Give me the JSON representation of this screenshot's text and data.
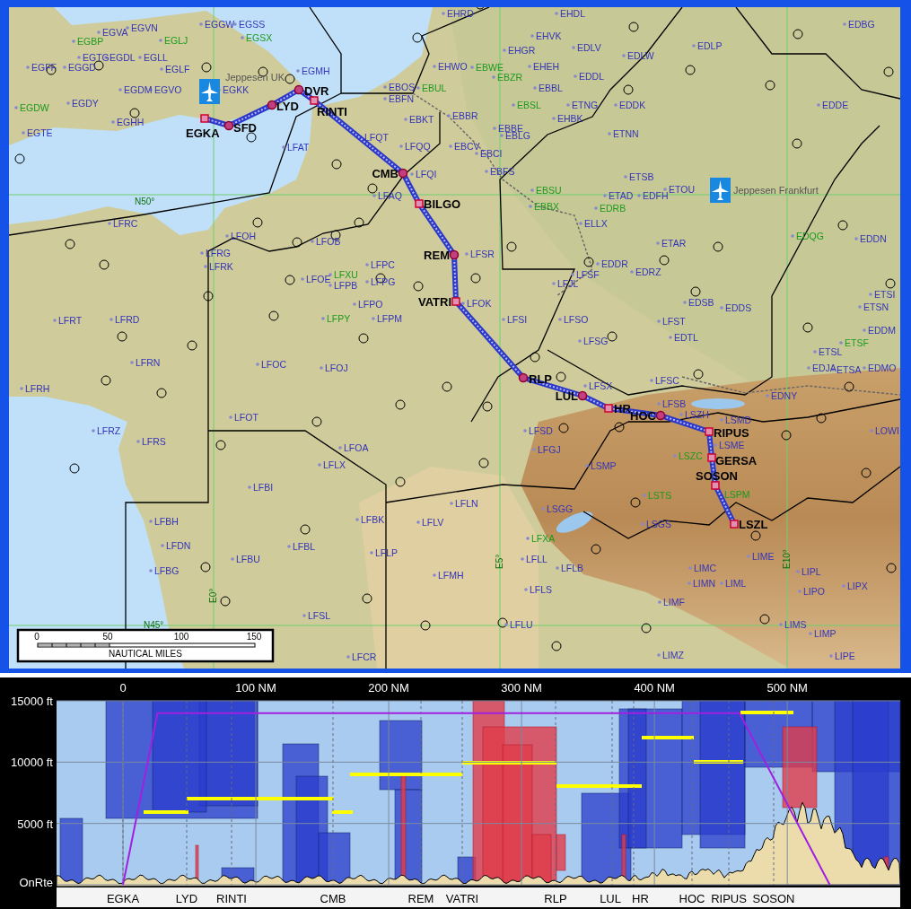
{
  "map": {
    "airports": [
      {
        "text": "EHRD",
        "color": "#3434b8"
      },
      {
        "text": "EHDL",
        "color": "#3434b8"
      },
      {
        "text": "EGVA",
        "color": "#3434b8"
      },
      {
        "text": "EGVN",
        "color": "#3434b8"
      },
      {
        "text": "EGGW",
        "color": "#3434b8"
      },
      {
        "text": "EGSS",
        "color": "#3434b8"
      },
      {
        "text": "EDBG",
        "color": "#3434b8"
      },
      {
        "text": "EGBP",
        "color": "#1c9a1c"
      },
      {
        "text": "EGLJ",
        "color": "#1c9a1c"
      },
      {
        "text": "EGSX",
        "color": "#1c9a1c"
      },
      {
        "text": "EHVK",
        "color": "#3434b8"
      },
      {
        "text": "EGTG",
        "color": "#3434b8"
      },
      {
        "text": "EGDL",
        "color": "#3434b8"
      },
      {
        "text": "EGLL",
        "color": "#3434b8"
      },
      {
        "text": "EHGR",
        "color": "#3434b8"
      },
      {
        "text": "EDLV",
        "color": "#3434b8"
      },
      {
        "text": "EDLW",
        "color": "#3434b8"
      },
      {
        "text": "EDLP",
        "color": "#3434b8"
      },
      {
        "text": "EGFF",
        "color": "#3434b8"
      },
      {
        "text": "EGGD",
        "color": "#3434b8"
      },
      {
        "text": "EGLF",
        "color": "#3434b8"
      },
      {
        "text": "EGMH",
        "color": "#3434b8"
      },
      {
        "text": "EHWO",
        "color": "#3434b8"
      },
      {
        "text": "EBWE",
        "color": "#1c9a1c"
      },
      {
        "text": "EHEH",
        "color": "#3434b8"
      },
      {
        "text": "EBZR",
        "color": "#1c9a1c"
      },
      {
        "text": "EDDL",
        "color": "#3434b8"
      },
      {
        "text": "EGDM",
        "color": "#3434b8"
      },
      {
        "text": "EGVO",
        "color": "#3434b8"
      },
      {
        "text": "EGKK",
        "color": "#3434b8"
      },
      {
        "text": "EBOS",
        "color": "#3434b8"
      },
      {
        "text": "EBUL",
        "color": "#1c9a1c"
      },
      {
        "text": "EBBL",
        "color": "#3434b8"
      },
      {
        "text": "EGDW",
        "color": "#1c9a1c"
      },
      {
        "text": "EGDY",
        "color": "#3434b8"
      },
      {
        "text": "EBFN",
        "color": "#3434b8"
      },
      {
        "text": "EBSL",
        "color": "#1c9a1c"
      },
      {
        "text": "ETNG",
        "color": "#3434b8"
      },
      {
        "text": "EDDK",
        "color": "#3434b8"
      },
      {
        "text": "EDDE",
        "color": "#3434b8"
      },
      {
        "text": "EGHH",
        "color": "#3434b8"
      },
      {
        "text": "EBKT",
        "color": "#3434b8"
      },
      {
        "text": "EBBR",
        "color": "#3434b8"
      },
      {
        "text": "EHBK",
        "color": "#3434b8"
      },
      {
        "text": "EGTE",
        "color": "#3434b8"
      },
      {
        "text": "LFQT",
        "color": "#3434b8"
      },
      {
        "text": "EBBE",
        "color": "#3434b8"
      },
      {
        "text": "EBLG",
        "color": "#3434b8"
      },
      {
        "text": "ETNN",
        "color": "#3434b8"
      },
      {
        "text": "LFAT",
        "color": "#3434b8"
      },
      {
        "text": "LFQQ",
        "color": "#3434b8"
      },
      {
        "text": "EBCV",
        "color": "#3434b8"
      },
      {
        "text": "EBCI",
        "color": "#3434b8"
      },
      {
        "text": "LFQI",
        "color": "#3434b8"
      },
      {
        "text": "EBFS",
        "color": "#3434b8"
      },
      {
        "text": "ETSB",
        "color": "#3434b8"
      },
      {
        "text": "LFAQ",
        "color": "#3434b8"
      },
      {
        "text": "EBSU",
        "color": "#1c9a1c"
      },
      {
        "text": "ETAD",
        "color": "#3434b8"
      },
      {
        "text": "EDFH",
        "color": "#3434b8"
      },
      {
        "text": "ETOU",
        "color": "#3434b8"
      },
      {
        "text": "EBBX",
        "color": "#1c9a1c"
      },
      {
        "text": "EDRB",
        "color": "#1c9a1c"
      },
      {
        "text": "LFRC",
        "color": "#3434b8"
      },
      {
        "text": "ELLX",
        "color": "#3434b8"
      },
      {
        "text": "LFOH",
        "color": "#3434b8"
      },
      {
        "text": "LFOB",
        "color": "#3434b8"
      },
      {
        "text": "ETAR",
        "color": "#3434b8"
      },
      {
        "text": "EDQG",
        "color": "#1c9a1c"
      },
      {
        "text": "EDDN",
        "color": "#3434b8"
      },
      {
        "text": "LFRG",
        "color": "#3434b8"
      },
      {
        "text": "LFSR",
        "color": "#3434b8"
      },
      {
        "text": "LFRK",
        "color": "#3434b8"
      },
      {
        "text": "LFPC",
        "color": "#3434b8"
      },
      {
        "text": "EDDR",
        "color": "#3434b8"
      },
      {
        "text": "LFOE",
        "color": "#3434b8"
      },
      {
        "text": "LFXU",
        "color": "#1c9a1c"
      },
      {
        "text": "LFPB",
        "color": "#3434b8"
      },
      {
        "text": "LFPG",
        "color": "#3434b8"
      },
      {
        "text": "LFJL",
        "color": "#3434b8"
      },
      {
        "text": "LFSF",
        "color": "#3434b8"
      },
      {
        "text": "EDRZ",
        "color": "#3434b8"
      },
      {
        "text": "LFPO",
        "color": "#3434b8"
      },
      {
        "text": "LFOK",
        "color": "#3434b8"
      },
      {
        "text": "EDSB",
        "color": "#3434b8"
      },
      {
        "text": "EDDS",
        "color": "#3434b8"
      },
      {
        "text": "ETSN",
        "color": "#3434b8"
      },
      {
        "text": "ETSI",
        "color": "#3434b8"
      },
      {
        "text": "LFRT",
        "color": "#3434b8"
      },
      {
        "text": "LFRD",
        "color": "#3434b8"
      },
      {
        "text": "LFPY",
        "color": "#1c9a1c"
      },
      {
        "text": "LFPM",
        "color": "#3434b8"
      },
      {
        "text": "LFSI",
        "color": "#3434b8"
      },
      {
        "text": "LFSO",
        "color": "#3434b8"
      },
      {
        "text": "LFST",
        "color": "#3434b8"
      },
      {
        "text": "LFSG",
        "color": "#3434b8"
      },
      {
        "text": "EDTL",
        "color": "#3434b8"
      },
      {
        "text": "EDDM",
        "color": "#3434b8"
      },
      {
        "text": "ETSL",
        "color": "#3434b8"
      },
      {
        "text": "ETSF",
        "color": "#1c9a1c"
      },
      {
        "text": "LFRN",
        "color": "#3434b8"
      },
      {
        "text": "LFOC",
        "color": "#3434b8"
      },
      {
        "text": "LFOJ",
        "color": "#3434b8"
      },
      {
        "text": "EDJA",
        "color": "#3434b8"
      },
      {
        "text": "ETSA",
        "color": "#3434b8"
      },
      {
        "text": "EDMO",
        "color": "#3434b8"
      },
      {
        "text": "LFRH",
        "color": "#3434b8"
      },
      {
        "text": "LFSX",
        "color": "#3434b8"
      },
      {
        "text": "LFSC",
        "color": "#3434b8"
      },
      {
        "text": "LFSB",
        "color": "#3434b8"
      },
      {
        "text": "EDNY",
        "color": "#3434b8"
      },
      {
        "text": "LFOT",
        "color": "#3434b8"
      },
      {
        "text": "LSZH",
        "color": "#3434b8"
      },
      {
        "text": "LSMD",
        "color": "#3434b8"
      },
      {
        "text": "LFRZ",
        "color": "#3434b8"
      },
      {
        "text": "LFSD",
        "color": "#3434b8"
      },
      {
        "text": "LOWI",
        "color": "#3434b8"
      },
      {
        "text": "LFRS",
        "color": "#3434b8"
      },
      {
        "text": "LFOA",
        "color": "#3434b8"
      },
      {
        "text": "LFGJ",
        "color": "#3434b8"
      },
      {
        "text": "LSME",
        "color": "#3434b8"
      },
      {
        "text": "LFLX",
        "color": "#3434b8"
      },
      {
        "text": "LSMP",
        "color": "#3434b8"
      },
      {
        "text": "LSZC",
        "color": "#1c9a1c"
      },
      {
        "text": "LFBI",
        "color": "#3434b8"
      },
      {
        "text": "LFLN",
        "color": "#3434b8"
      },
      {
        "text": "LSTS",
        "color": "#1c9a1c"
      },
      {
        "text": "LSPM",
        "color": "#1c9a1c"
      },
      {
        "text": "LSGG",
        "color": "#3434b8"
      },
      {
        "text": "LFBH",
        "color": "#3434b8"
      },
      {
        "text": "LFBK",
        "color": "#3434b8"
      },
      {
        "text": "LFLV",
        "color": "#3434b8"
      },
      {
        "text": "LSGS",
        "color": "#3434b8"
      },
      {
        "text": "LFDN",
        "color": "#3434b8"
      },
      {
        "text": "LFBL",
        "color": "#3434b8"
      },
      {
        "text": "LFXA",
        "color": "#1c9a1c"
      },
      {
        "text": "LFBU",
        "color": "#3434b8"
      },
      {
        "text": "LFLP",
        "color": "#3434b8"
      },
      {
        "text": "LFLL",
        "color": "#3434b8"
      },
      {
        "text": "LIME",
        "color": "#3434b8"
      },
      {
        "text": "LFBG",
        "color": "#3434b8"
      },
      {
        "text": "LFMH",
        "color": "#3434b8"
      },
      {
        "text": "LFLB",
        "color": "#3434b8"
      },
      {
        "text": "LIMC",
        "color": "#3434b8"
      },
      {
        "text": "LIPL",
        "color": "#3434b8"
      },
      {
        "text": "LFLS",
        "color": "#3434b8"
      },
      {
        "text": "LIMN",
        "color": "#3434b8"
      },
      {
        "text": "LIML",
        "color": "#3434b8"
      },
      {
        "text": "LIPO",
        "color": "#3434b8"
      },
      {
        "text": "LIPX",
        "color": "#3434b8"
      },
      {
        "text": "LIMF",
        "color": "#3434b8"
      },
      {
        "text": "LFSL",
        "color": "#3434b8"
      },
      {
        "text": "LFLU",
        "color": "#3434b8"
      },
      {
        "text": "LIMS",
        "color": "#3434b8"
      },
      {
        "text": "LIMP",
        "color": "#3434b8"
      },
      {
        "text": "LFCR",
        "color": "#3434b8"
      },
      {
        "text": "LIMZ",
        "color": "#3434b8"
      },
      {
        "text": "LIPE",
        "color": "#3434b8"
      }
    ],
    "waypoints": [
      {
        "text": "EGKA",
        "kind": "fix"
      },
      {
        "text": "SFD",
        "kind": "navaid"
      },
      {
        "text": "LYD",
        "kind": "navaid"
      },
      {
        "text": "DVR",
        "kind": "navaid"
      },
      {
        "text": "RINTI",
        "kind": "fix"
      },
      {
        "text": "CMB",
        "kind": "navaid"
      },
      {
        "text": "BILGO",
        "kind": "fix"
      },
      {
        "text": "REM",
        "kind": "navaid"
      },
      {
        "text": "VATRI",
        "kind": "fix"
      },
      {
        "text": "RLP",
        "kind": "navaid"
      },
      {
        "text": "LUL",
        "kind": "navaid"
      },
      {
        "text": "HR",
        "kind": "fix"
      },
      {
        "text": "HOC",
        "kind": "navaid"
      },
      {
        "text": "RIPUS",
        "kind": "fix"
      },
      {
        "text": "GERSA",
        "kind": "fix"
      },
      {
        "text": "SOSON",
        "kind": "fix"
      },
      {
        "text": "LSZL",
        "kind": "fix"
      }
    ],
    "company_labels": [
      "Jeppesen UK",
      "Jeppesen Frankfurt"
    ],
    "grid_labels": [
      "N50°",
      "N45°",
      "E0°",
      "E5°",
      "E10°"
    ],
    "scale_bar": {
      "ticks": [
        "0",
        "50",
        "100",
        "150"
      ],
      "unit": "NAUTICAL MILES"
    }
  },
  "profile": {
    "chart_data": {
      "type": "line",
      "x": [
        0,
        26,
        464,
        532
      ],
      "series": [
        {
          "color": "#a020e0",
          "values": [
            0,
            14000,
            14000,
            0
          ]
        }
      ],
      "xlim": [
        -50,
        585
      ],
      "ylim": [
        0,
        15000
      ],
      "grid": true,
      "xticks": [
        {
          "value": 0,
          "label": "0"
        },
        {
          "value": 100,
          "label": "100 NM"
        },
        {
          "value": 200,
          "label": "200 NM"
        },
        {
          "value": 300,
          "label": "300 NM"
        },
        {
          "value": 400,
          "label": "400 NM"
        },
        {
          "value": 500,
          "label": "500 NM"
        }
      ],
      "yticks": [
        {
          "value": 0,
          "label": "OnRte"
        },
        {
          "value": 5000,
          "label": "5000 ft"
        },
        {
          "value": 10000,
          "label": "10000 ft"
        },
        {
          "value": 15000,
          "label": "15000 ft"
        }
      ]
    },
    "waypoint_labels": [
      "EGKA",
      "LYD",
      "RINTI",
      "CMB",
      "REM",
      "VATRI",
      "RLP",
      "LUL",
      "HR",
      "HOC",
      "RIPUS",
      "SOSON"
    ]
  }
}
